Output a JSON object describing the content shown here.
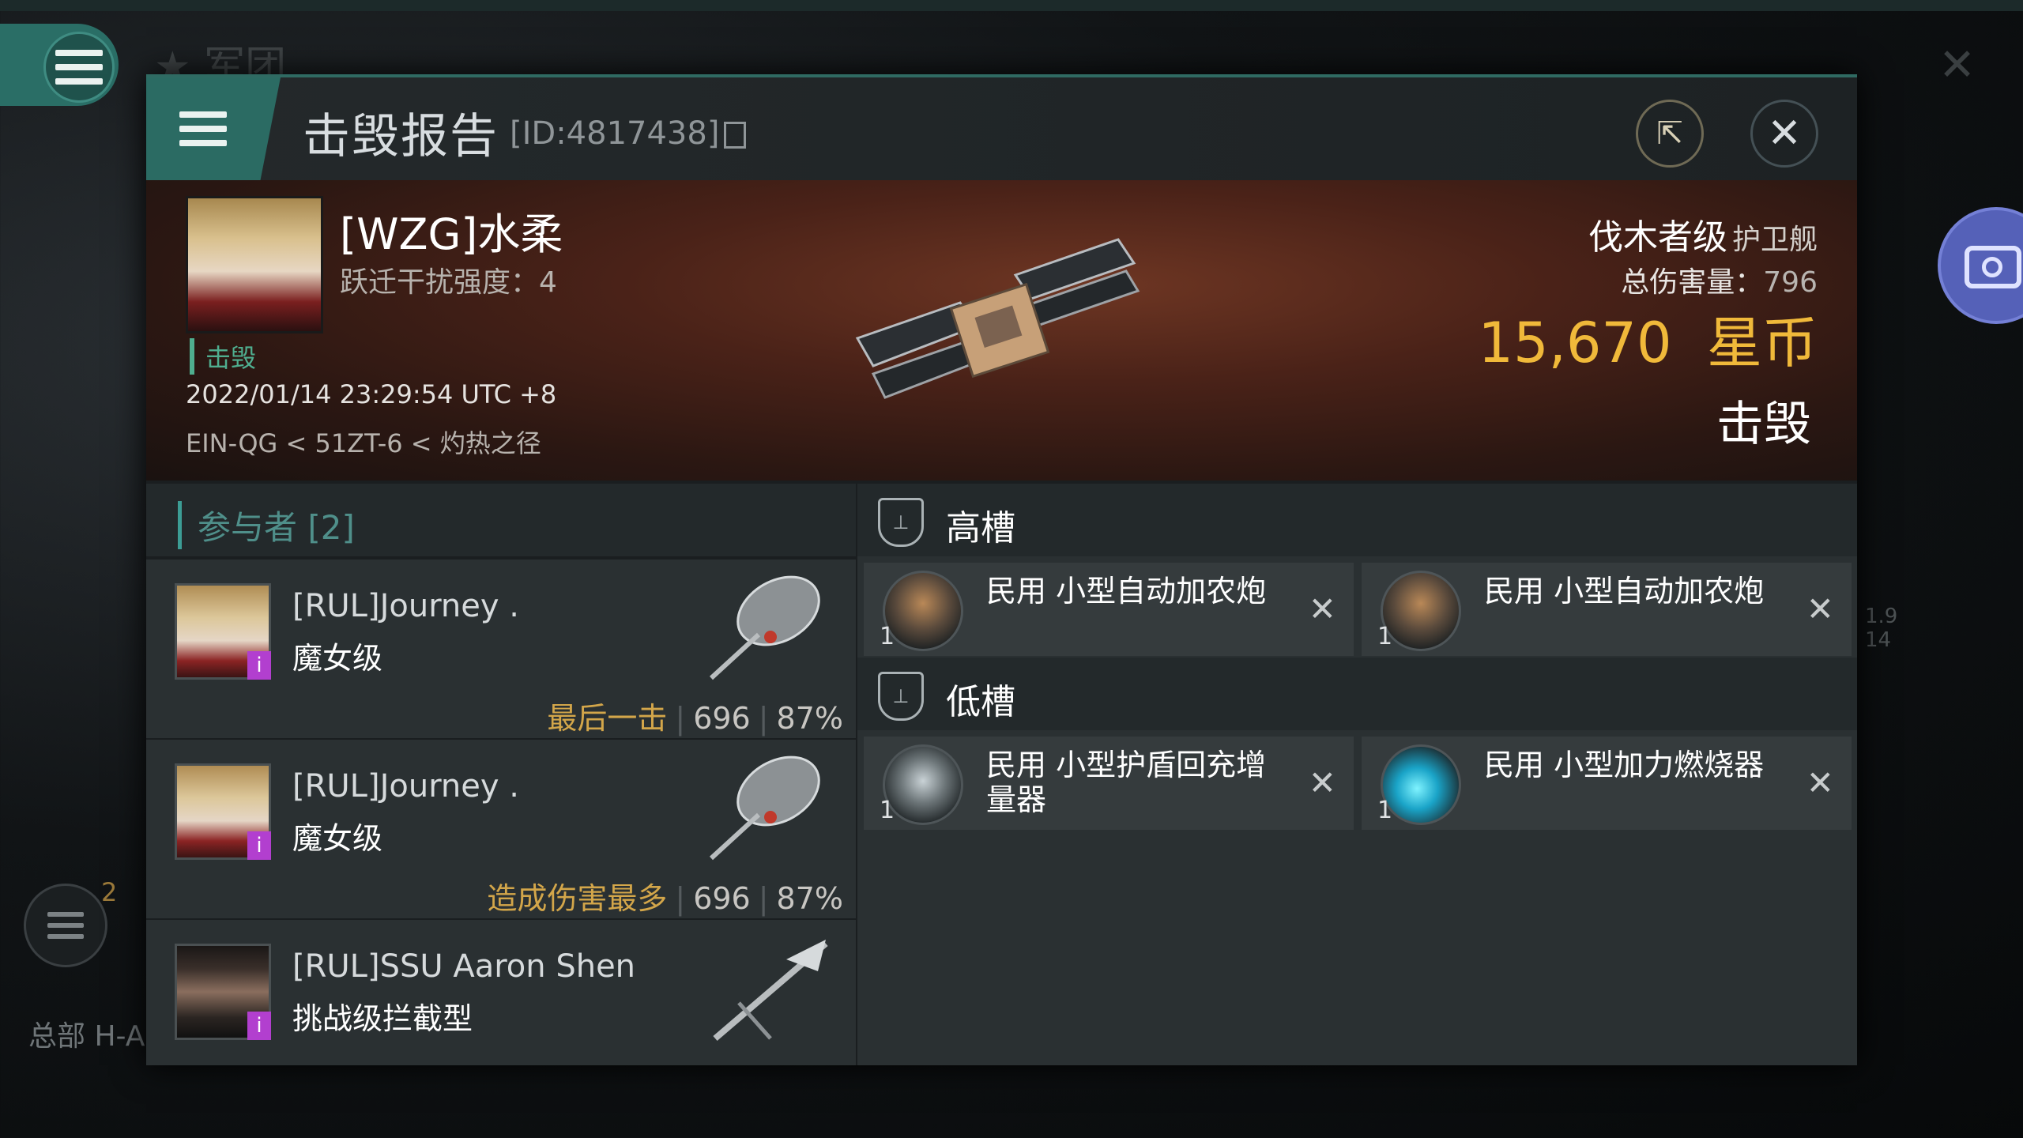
{
  "background": {
    "title": "★ 军团",
    "hq_text": "总部 H-AI",
    "badge_count": "2",
    "side_numbers": [
      "1.9",
      "14"
    ]
  },
  "header": {
    "title": "击毁报告",
    "id_text": "[ID:4817438]"
  },
  "victim": {
    "name": "[WZG]水柔",
    "warp_disruption": "跃迁干扰强度：4",
    "status": "击毁",
    "timestamp": "2022/01/14 23:29:54 UTC +8",
    "location": "EIN-QG < 51ZT-6 < 灼热之径",
    "ship_name": "伐木者级",
    "ship_type": "护卫舰",
    "total_damage_label": "总伤害量：",
    "total_damage_value": "796",
    "isk_value": "15,670",
    "isk_unit": "星币",
    "result": "击毁"
  },
  "participants": {
    "title": "参与者 [2]",
    "rows": [
      {
        "name": "[RUL]Journey .",
        "ship": "魔女级",
        "tag": "最后一击",
        "damage": "696",
        "percent": "87%",
        "badge": "i"
      },
      {
        "name": "[RUL]Journey .",
        "ship": "魔女级",
        "tag": "造成伤害最多",
        "damage": "696",
        "percent": "87%",
        "badge": "i"
      },
      {
        "name": "[RUL]SSU Aaron Shen",
        "ship": "挑战级拦截型",
        "badge": "i"
      }
    ]
  },
  "slots": {
    "high": {
      "label": "高槽",
      "items": [
        {
          "name": "民用 小型自动加农炮",
          "qty": "1",
          "icon": "autocannon-icon"
        },
        {
          "name": "民用 小型自动加农炮",
          "qty": "1",
          "icon": "autocannon-icon"
        }
      ]
    },
    "low": {
      "label": "低槽",
      "items": [
        {
          "name": "民用 小型护盾回充增量器",
          "qty": "1",
          "icon": "shield-recharger-icon"
        },
        {
          "name": "民用 小型加力燃烧器",
          "qty": "1",
          "icon": "afterburner-icon"
        }
      ]
    },
    "remove_glyph": "✕"
  },
  "colors": {
    "accent_teal": "#2b6b63",
    "isk_gold": "#f0b93a",
    "destroyed_green": "#4fae8f",
    "tag_gold": "#d3a64a"
  }
}
